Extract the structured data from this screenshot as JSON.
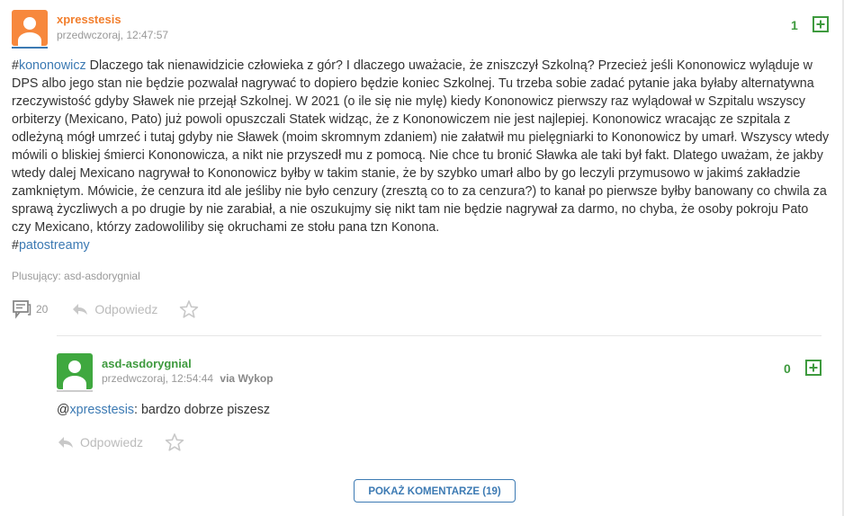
{
  "post": {
    "author": "xpresstesis",
    "timestamp": "przedwczoraj, 12:47:57",
    "votes": "1",
    "hash1": "#",
    "tag1": "kononowicz",
    "text": " Dlaczego tak nienawidzicie człowieka z gór? I dlaczego uważacie, że zniszczył Szkolną? Przecież jeśli Kononowicz wyląduje w DPS albo jego stan nie będzie pozwalał nagrywać to dopiero będzie koniec Szkolnej. Tu trzeba sobie zadać pytanie jaka byłaby alternatywna rzeczywistość gdyby Sławek nie przejął Szkolnej. W 2021 (o ile się nie mylę) kiedy Kononowicz pierwszy raz wylądował w Szpitalu wszyscy orbiterzy (Mexicano, Pato) już powoli opuszczali Statek widząc, że z Kononowiczem nie jest najlepiej. Kononowicz wracając ze szpitala z odleżyną mógł umrzeć i tutaj gdyby nie Sławek (moim skromnym zdaniem) nie załatwił mu pielęgniarki to Kononowicz by umarł. Wszyscy wtedy mówili o bliskiej śmierci Kononowicza, a nikt nie przyszedł mu z pomocą. Nie chce tu bronić Sławka ale taki był fakt. Dlatego uważam, że jakby wtedy dalej Mexicano nagrywał to Kononowicz byłby w takim stanie, że by szybko umarł albo by go leczyli przymusowo w jakimś zakładzie zamkniętym. Mówicie, że cenzura itd ale jeśliby nie było cenzury (zresztą co to za cenzura?) to kanał po pierwsze byłby banowany co chwila za sprawą życzliwych a po drugie by nie zarabiał, a nie oszukujmy się nikt tam nie będzie nagrywał za darmo, no chyba, że osoby pokroju Pato czy Mexicano, którzy zadowoliliby się okruchami ze stołu pana tzn Konona.",
    "hash2": "#",
    "tag2": "patostreamy",
    "plusujacy": "Plusujący: asd-asdorygnial",
    "comments_count": "20",
    "reply_label": "Odpowiedz",
    "author_color": "#f27f2e",
    "avatar_color": "#f7883d"
  },
  "reply": {
    "author": "asd-asdorygnial",
    "timestamp": "przedwczoraj, 12:54:44",
    "via": "via Wykop",
    "votes": "0",
    "mention_at": "@",
    "mention": "xpresstesis",
    "text": ": bardzo dobrze piszesz",
    "reply_label": "Odpowiedz",
    "author_color": "#3e9a3e",
    "avatar_color": "#3fa83f"
  },
  "show_more": "POKAŻ KOMENTARZE (19)",
  "icons": {
    "plus": "plus-square-icon",
    "comments": "comments-icon",
    "reply": "reply-arrow-icon",
    "favorite": "star-icon"
  },
  "colors": {
    "link": "#3c7ab3",
    "vote_green": "#3e9a3e",
    "muted": "#999999"
  }
}
